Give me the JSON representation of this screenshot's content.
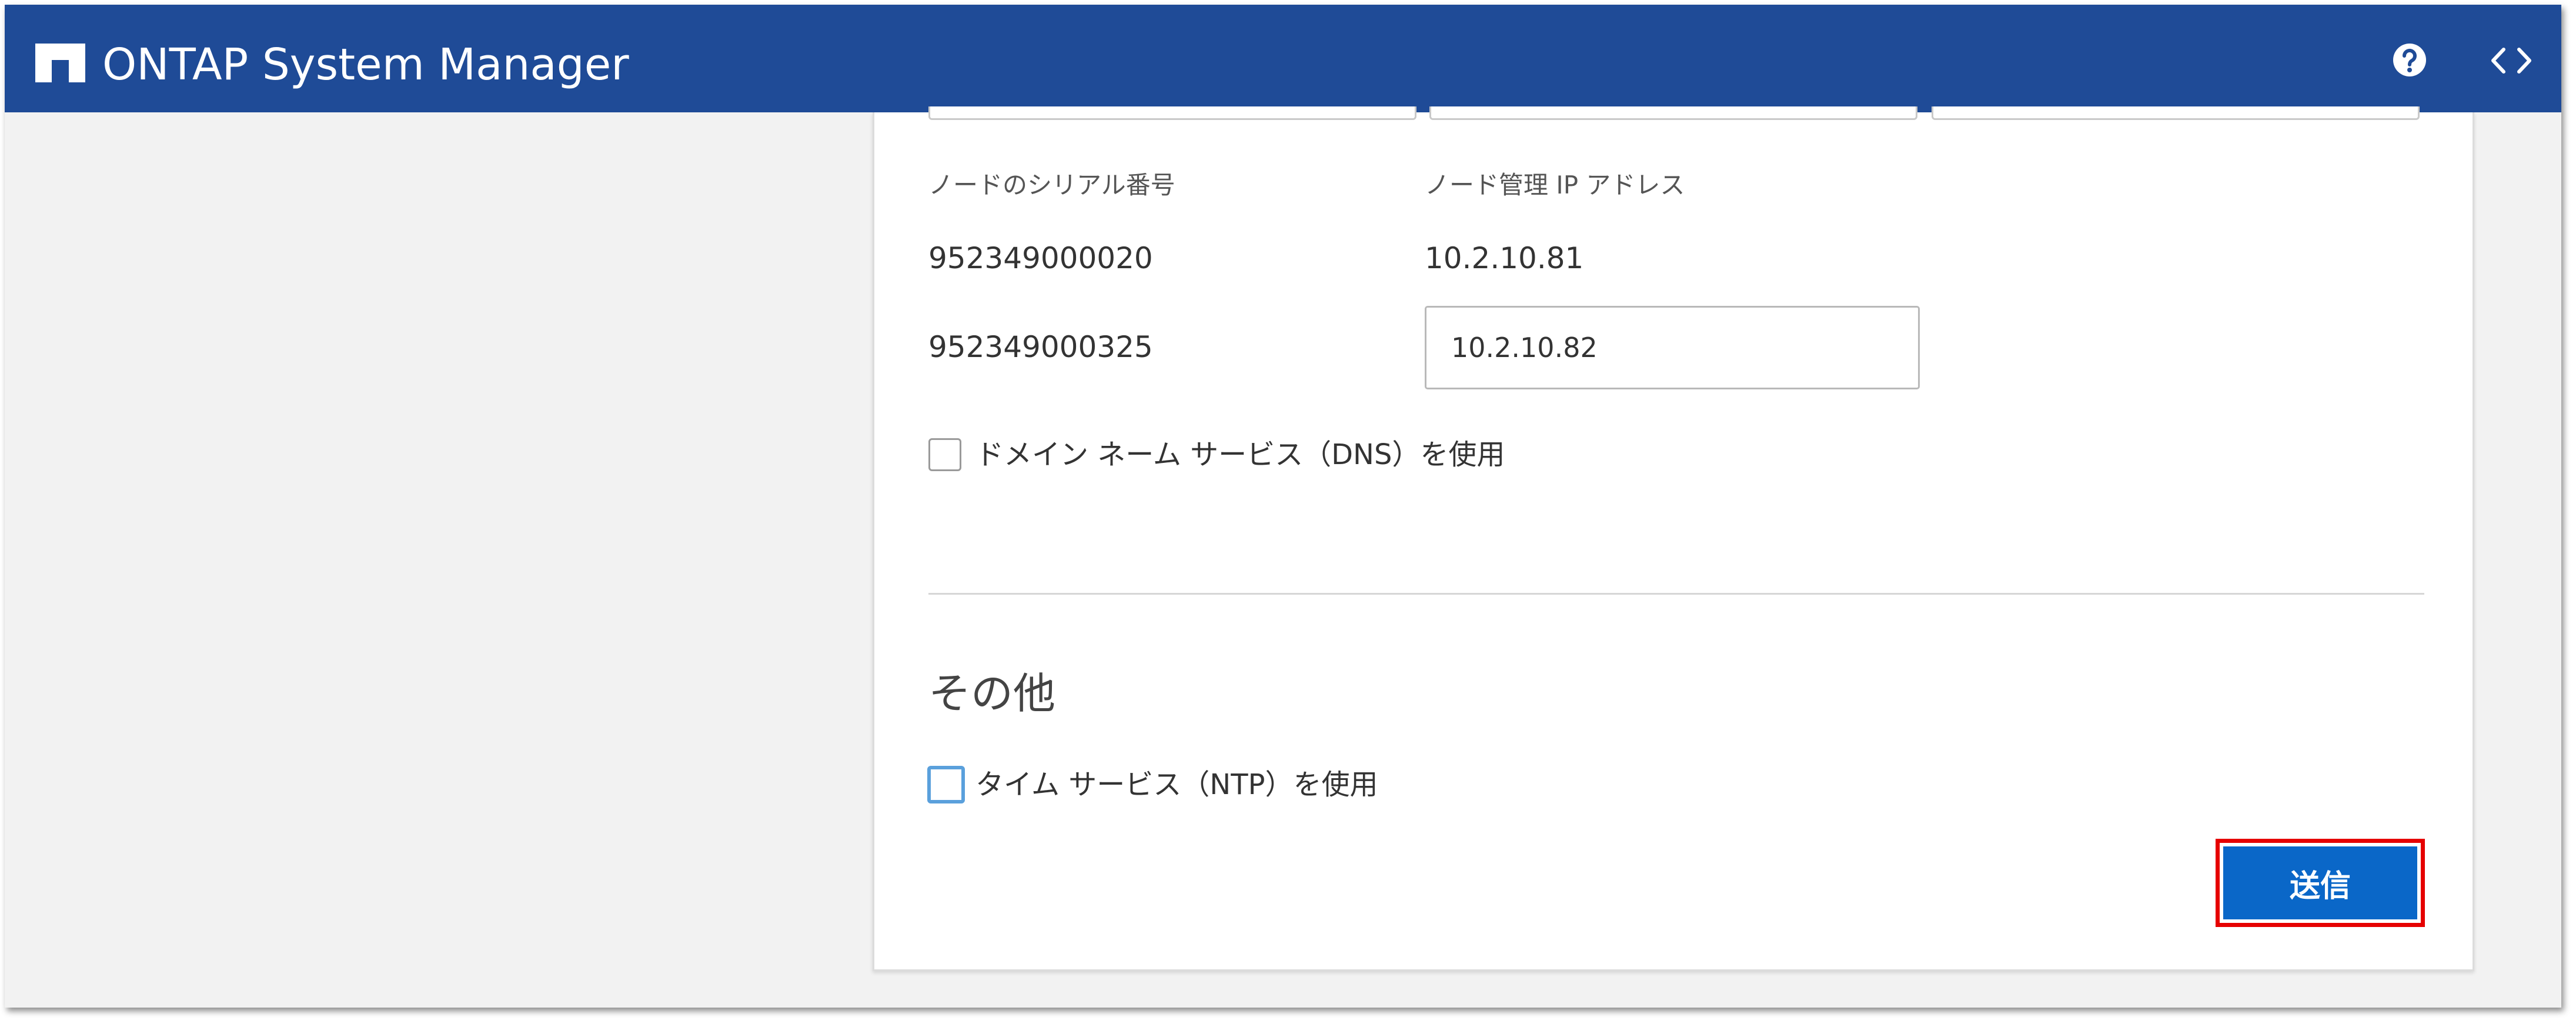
{
  "header": {
    "app_title": "ONTAP System Manager",
    "help_icon": "help-circle-icon",
    "code_icon": "code-brackets-icon",
    "background_color": "#1f4b97"
  },
  "nodes": {
    "serial_label": "ノードのシリアル番号",
    "ip_label": "ノード管理 IP アドレス",
    "rows": [
      {
        "serial": "952349000020",
        "ip": "10.2.10.81"
      },
      {
        "serial": "952349000325",
        "ip": "10.2.10.82"
      }
    ]
  },
  "dns": {
    "label": "ドメイン ネーム サービス（DNS）を使用",
    "checked": false
  },
  "other": {
    "title": "その他",
    "ntp_label": "タイム サービス（NTP）を使用",
    "ntp_checked": false
  },
  "submit": {
    "label": "送信",
    "color": "#0a67c8",
    "highlight_color": "#e60000"
  }
}
